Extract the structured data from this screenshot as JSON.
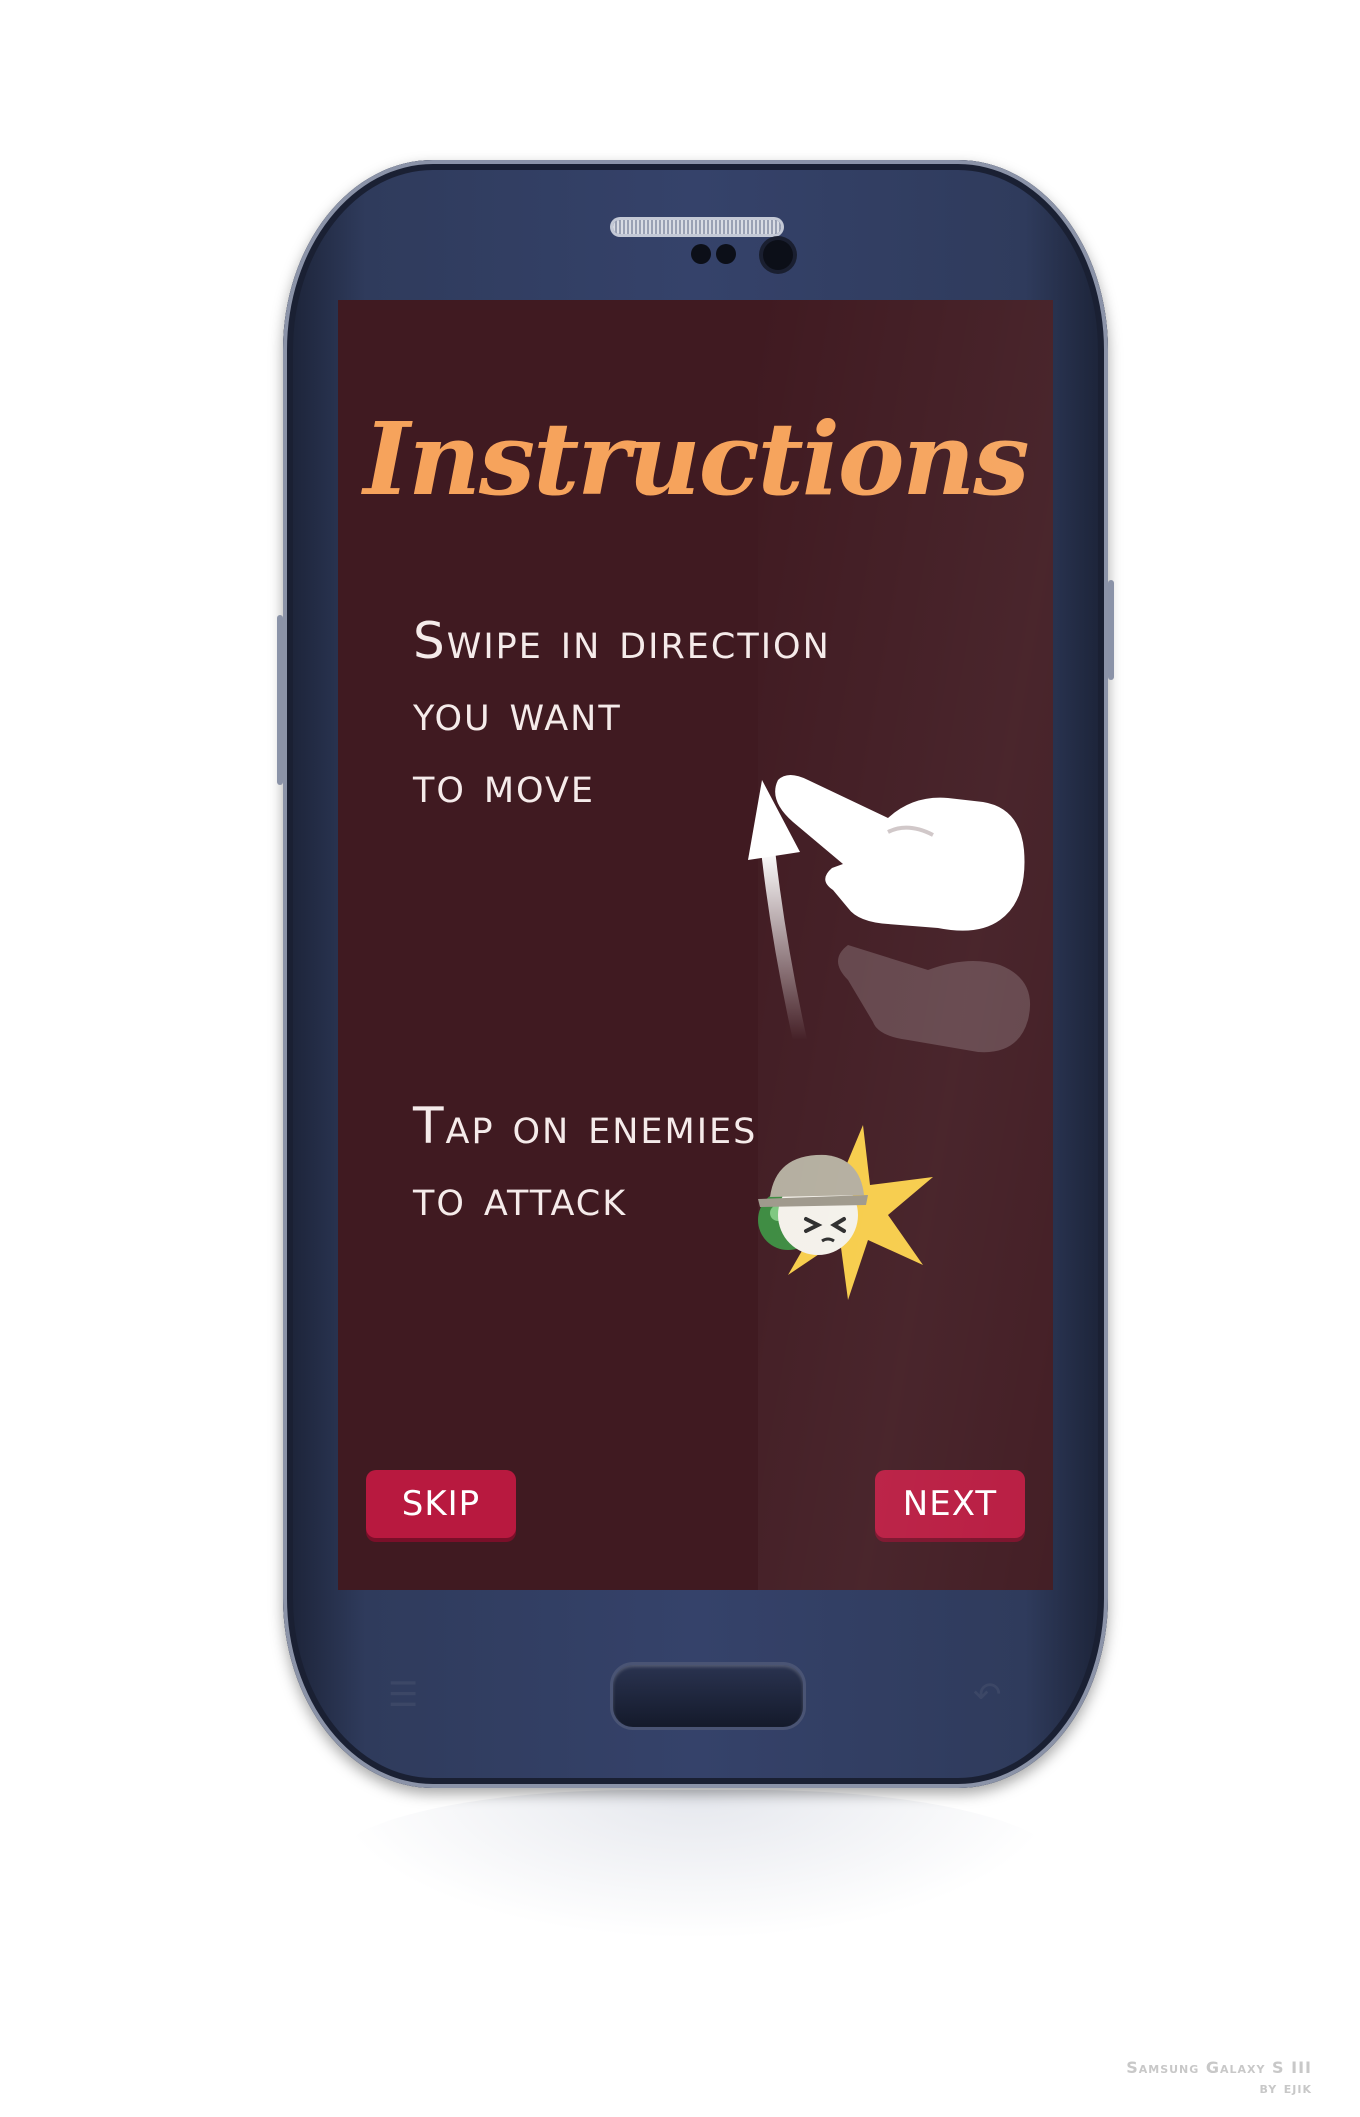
{
  "screen": {
    "title": "Instructions",
    "instruction_swipe": [
      "Swipe in direction",
      "you want",
      "to move"
    ],
    "instruction_tap": [
      "Tap on enemies",
      "to attack"
    ],
    "skip_label": "SKIP",
    "next_label": "NEXT"
  },
  "device": {
    "name": "Samsung Galaxy S III",
    "credit": "by ejik"
  },
  "colors": {
    "background": "#401a21",
    "title": "#f6a35c",
    "button": "#b8193f",
    "text": "#f5ebea"
  }
}
